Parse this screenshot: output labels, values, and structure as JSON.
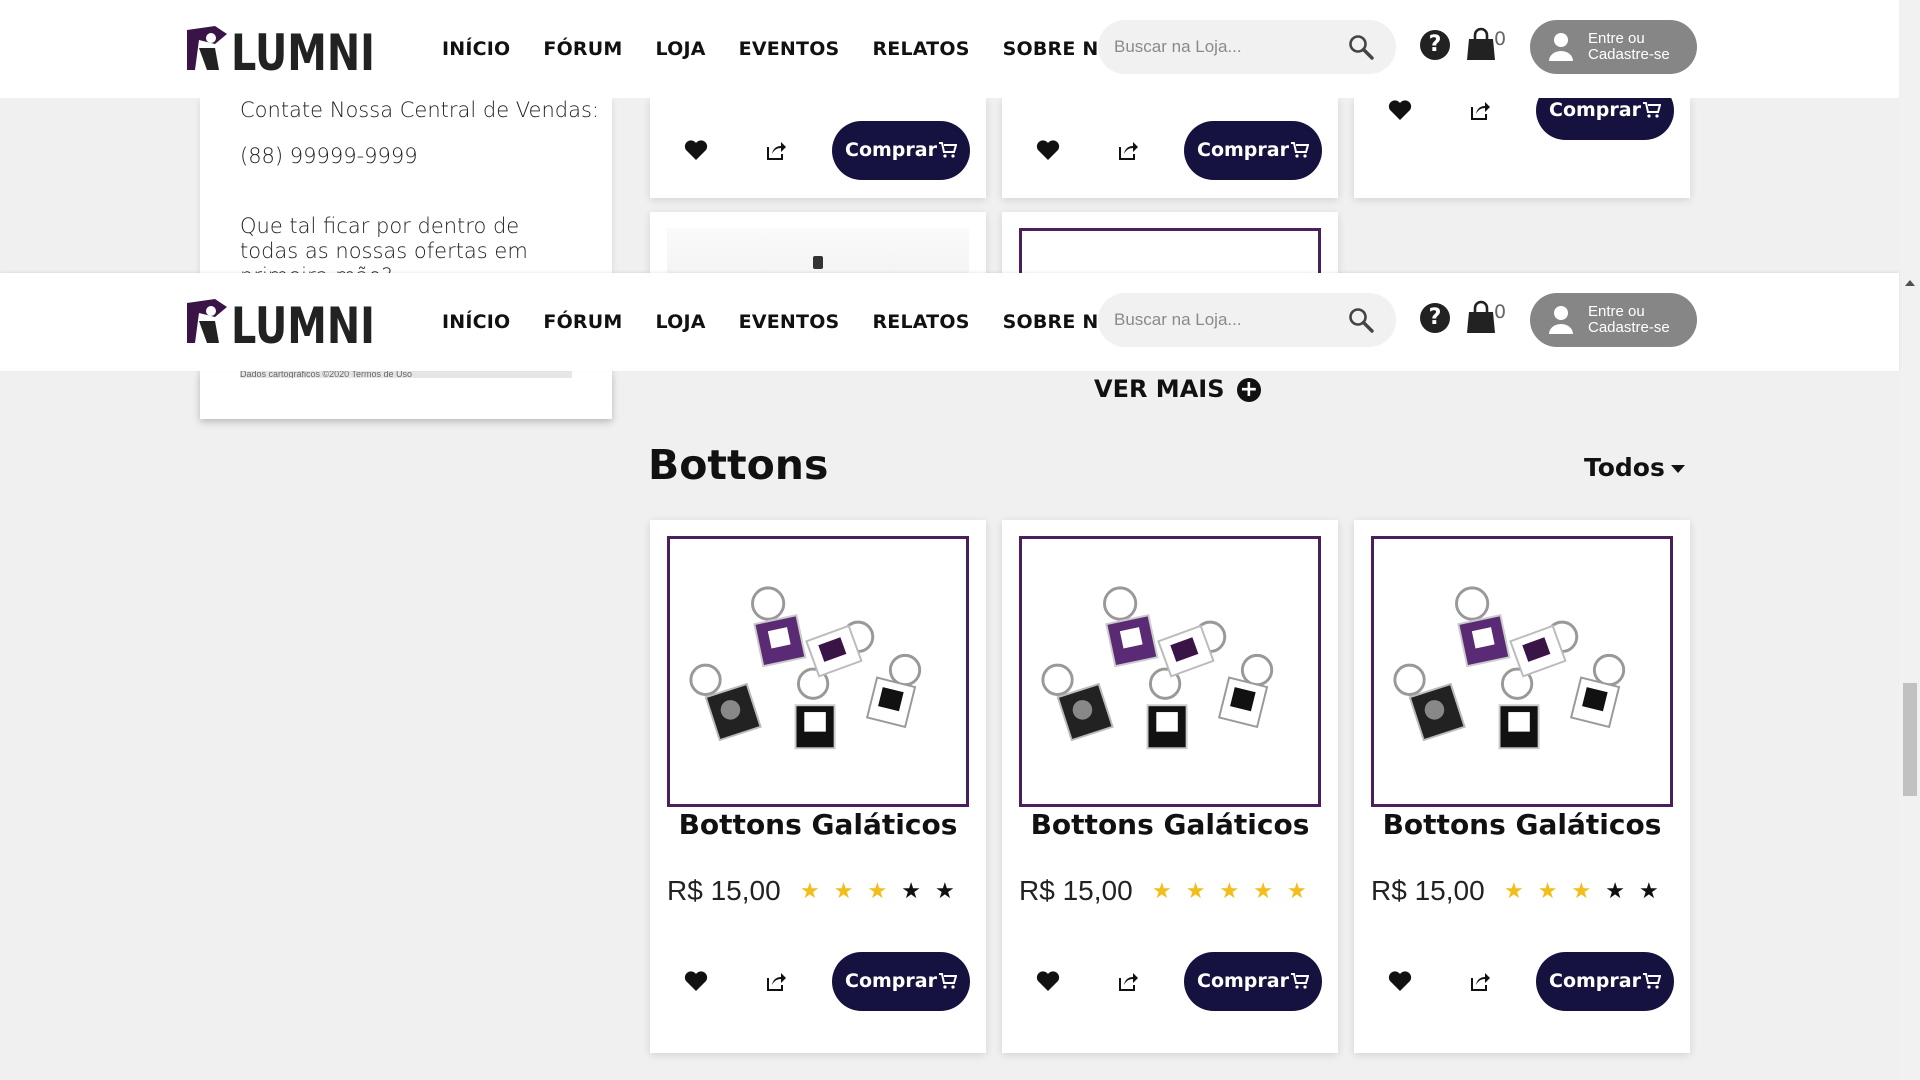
{
  "header": {
    "logo_text": "LUMNI",
    "nav": [
      "INÍCIO",
      "FÓRUM",
      "LOJA",
      "EVENTOS",
      "RELATOS",
      "SOBRE NÓS"
    ],
    "search_placeholder": "Buscar na Loja...",
    "help_symbol": "?",
    "cart_count": "0",
    "login_line1": "Entre ou",
    "login_line2": "Cadastre-se"
  },
  "side": {
    "contact_label": "Contate Nossa Central de Vendas:",
    "phone": "(88) 99999-9999",
    "newsletter": "Que tal ficar por dentro de todas as nossas ofertas em primeira mão?",
    "map_credits": "Dados cartográficos ©2020   Termos de Uso"
  },
  "buy_label": "Comprar",
  "ver_mais": "VER MAIS",
  "section": {
    "title": "Bottons",
    "filter": "Todos"
  },
  "products": [
    {
      "name": "Bottons Galáticos",
      "price": "R$ 15,00",
      "rating": 3
    },
    {
      "name": "Bottons Galáticos",
      "price": "R$ 15,00",
      "rating": 5
    },
    {
      "name": "Bottons Galáticos",
      "price": "R$ 15,00",
      "rating": 3
    }
  ],
  "colors": {
    "brand_purple": "#4a1f5b",
    "button_navy": "#16123f",
    "star_yellow": "#f4bd1b"
  }
}
